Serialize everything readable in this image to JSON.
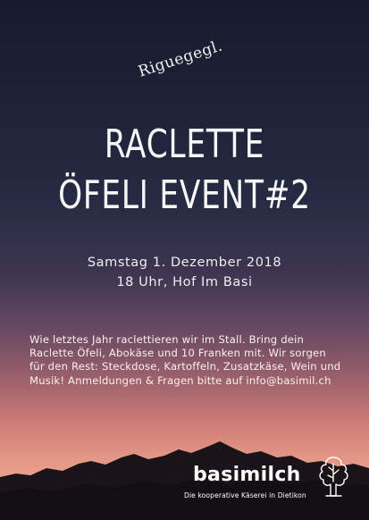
{
  "poster": {
    "tagline": "Riguegegl.",
    "title_line1": "RACLETTE",
    "title_line2": "ÖFELI EVENT#2",
    "date": "Samstag 1. Dezember 2018",
    "time_place": "18 Uhr, Hof Im Basi",
    "body": "Wie letztes Jahr raclettieren wir im Stall. Bring dein Raclette Öfeli, Abokäse und 10 Franken mit. Wir sorgen für den Rest: Steckdose, Kartoffeln, Zusatzkäse, Wein und Musik! Anmeldungen & Fragen bitte auf info@basimil.ch",
    "logo_icon": "tree-icon",
    "brand_name": "basimilch",
    "brand_subtitle": "Die kooperative Käserei in Dietikon"
  },
  "colors": {
    "sky_top": "#161b2e",
    "sky_mid": "#3b3550",
    "sky_glow": "#e39786",
    "mountains": "#1a1418",
    "text": "#f7f7f7"
  }
}
